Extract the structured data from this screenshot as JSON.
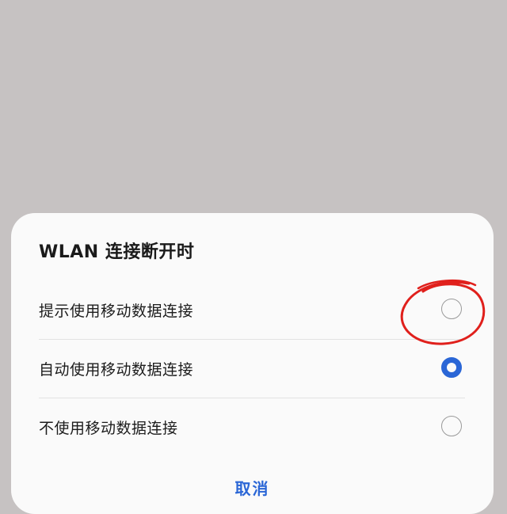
{
  "dialog": {
    "title": "WLAN 连接断开时",
    "options": [
      {
        "label": "提示使用移动数据连接",
        "selected": false
      },
      {
        "label": "自动使用移动数据连接",
        "selected": true
      },
      {
        "label": "不使用移动数据连接",
        "selected": false
      }
    ],
    "cancel_label": "取消"
  },
  "colors": {
    "accent": "#2a66d6",
    "annotation": "#e0201c",
    "backdrop": "#c6c2c2",
    "dialog_bg": "#fafafa"
  },
  "annotation": {
    "shape": "hand-drawn-circle"
  }
}
